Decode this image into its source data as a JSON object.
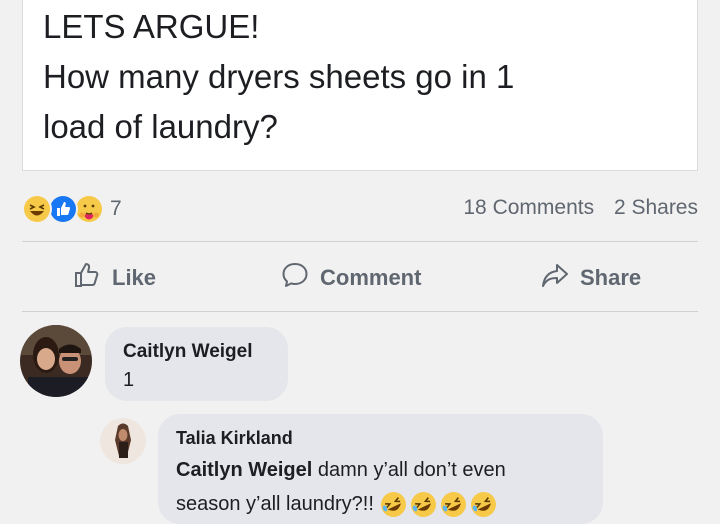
{
  "post": {
    "lines": [
      "LETS ARGUE!",
      "How many dryers sheets go in 1",
      "load of laundry?"
    ]
  },
  "stats": {
    "reactions": [
      "haha-icon",
      "like-icon",
      "care-icon"
    ],
    "reaction_count": "7",
    "comments": "18 Comments",
    "shares": "2 Shares"
  },
  "actions": {
    "like": "Like",
    "comment": "Comment",
    "share": "Share"
  },
  "comments": [
    {
      "author": "Caitlyn Weigel",
      "text": "1"
    },
    {
      "author": "Talia Kirkland",
      "mention": "Caitlyn Weigel",
      "line1": " damn y’all don’t even",
      "line2": "season y’all laundry?!!",
      "emojis": [
        "rofl-icon",
        "rofl-icon",
        "rofl-icon",
        "rofl-icon"
      ]
    }
  ],
  "colors": {
    "background": "#f1f1f1",
    "bubble": "#e4e6eb",
    "muted_text": "#606770",
    "like_blue": "#1877f2",
    "haha_yellow": "#f7c948"
  }
}
